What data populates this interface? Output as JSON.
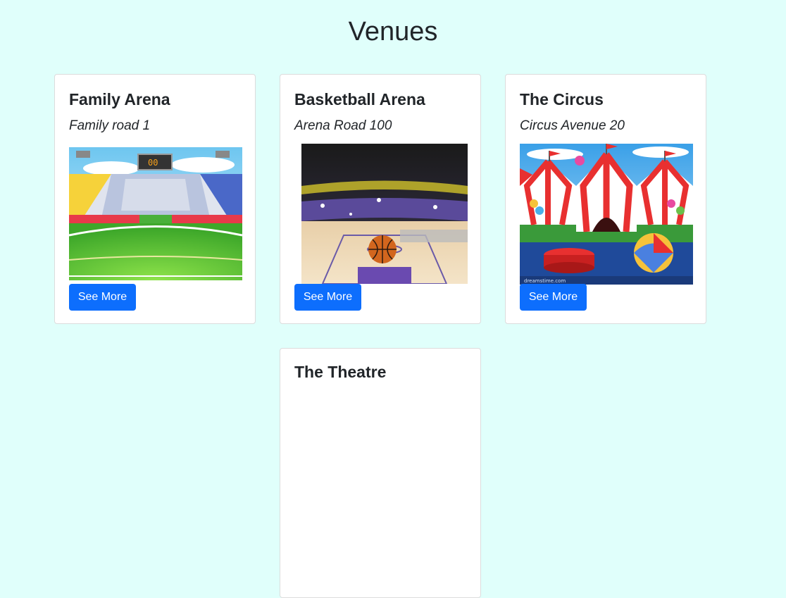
{
  "page": {
    "title": "Venues"
  },
  "venues": [
    {
      "name": "Family Arena",
      "address": "Family road 1",
      "button_label": "See More",
      "image": "stadium-illustration"
    },
    {
      "name": "Basketball Arena",
      "address": "Arena Road 100",
      "button_label": "See More",
      "image": "basketball-court-illustration"
    },
    {
      "name": "The Circus",
      "address": "Circus Avenue 20",
      "button_label": "See More",
      "image": "circus-tents-illustration"
    },
    {
      "name": "The Theatre"
    }
  ],
  "colors": {
    "background": "#e0fffb",
    "button": "#0d6efd",
    "card": "#ffffff"
  }
}
